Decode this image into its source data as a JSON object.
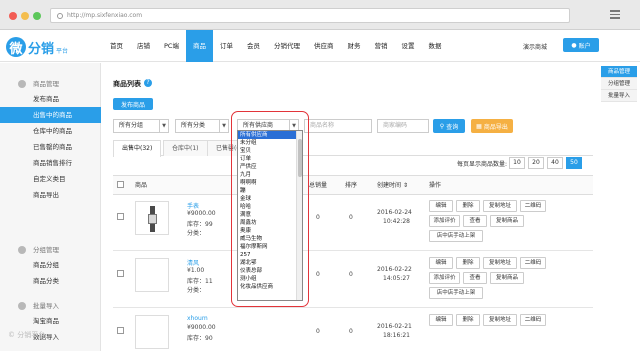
{
  "browser": {
    "url": "http://mp.sixfenxiao.com"
  },
  "logo": {
    "mark": "微",
    "name": "分销",
    "sub": "平台"
  },
  "topnav": {
    "items": [
      "首页",
      "店铺",
      "PC端",
      "商品",
      "订单",
      "会员",
      "分销代理",
      "供应商",
      "财务",
      "营销",
      "设置",
      "数据"
    ],
    "active_index": 3,
    "store_link": "演示商城",
    "account_label": "账户"
  },
  "sidebar": {
    "groups": [
      {
        "title": "商品管理",
        "items": [
          "发布商品",
          "出售中的商品",
          "仓库中的商品",
          "已售罄的商品",
          "商品销售排行",
          "自定义类目",
          "商品导出"
        ]
      },
      {
        "title": "分组管理",
        "items": [
          "商品分组",
          "商品分类"
        ]
      },
      {
        "title": "批量导入",
        "items": [
          "淘宝商品",
          "数据导入"
        ]
      }
    ],
    "active_item": "出售中的商品"
  },
  "right_panel": {
    "items": [
      "商品管理",
      "分组管理",
      "批量导入"
    ],
    "active_index": 0
  },
  "main": {
    "title": "商品列表",
    "publish_button": "发布商品",
    "filters": {
      "group": "所有分组",
      "category": "所有分类",
      "supplier": "所有供应商",
      "name_placeholder": "商品名称",
      "code_placeholder": "商家编码",
      "search_button": "查询",
      "export_button": "商品导出"
    },
    "tabs": [
      {
        "label": "出售中(32)"
      },
      {
        "label": "仓库中(1)"
      },
      {
        "label": "已售罄(0)"
      }
    ],
    "page_size_label": "每页显示商品数量:",
    "page_sizes": [
      "10",
      "20",
      "40",
      "50"
    ],
    "page_size_active": "50",
    "columns": [
      "商品",
      "总销量",
      "排序",
      "创建时间",
      "操作"
    ],
    "sort_icon": "sort-icon",
    "rows": [
      {
        "name": "手表",
        "price": "¥9000.00",
        "stock": "库存：99",
        "category": "分类：",
        "sales": "0",
        "sort": "0",
        "date": "2016-02-24",
        "time": "10:42:28",
        "thumb": "watch",
        "actions": [
          "编辑",
          "删除",
          "复制地址",
          "二维码",
          "添加评价",
          "查看",
          "复制商品",
          "店中店手动上架"
        ]
      },
      {
        "name": "清风",
        "price": "¥1.00",
        "stock": "库存：11",
        "category": "分类：",
        "sales": "0",
        "sort": "0",
        "date": "2016-02-22",
        "time": "14:05:27",
        "thumb": "blank",
        "actions": [
          "编辑",
          "删除",
          "复制地址",
          "二维码",
          "添加评价",
          "查看",
          "复制商品",
          "店中店手动上架"
        ]
      },
      {
        "name": "xhoum",
        "price": "¥9000.00",
        "stock": "库存：90",
        "category": "",
        "sales": "0",
        "sort": "0",
        "date": "2016-02-21",
        "time": "18:16:21",
        "thumb": "blank",
        "actions": [
          "编辑",
          "删除",
          "复制地址",
          "二维码"
        ]
      }
    ]
  },
  "supplier_dropdown": {
    "options": [
      "所有供应商",
      "未分组",
      "宝贝",
      "订单",
      "严供应",
      "九月",
      "啊啊啊",
      "蹦",
      "金球",
      "哈哈",
      "满意",
      "周鑫坊",
      "奥康",
      "威马生物",
      "福尔摩斯网",
      "257",
      "湖北鄂",
      "仪表总部",
      "测小组",
      "化妆品供应商"
    ],
    "selected_index": 0
  },
  "colors": {
    "accent": "#2a9ee8",
    "highlight": "#e2343a",
    "export": "#f5b043"
  }
}
